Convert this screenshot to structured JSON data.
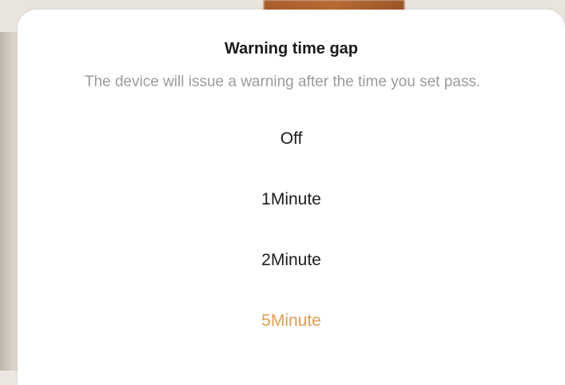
{
  "dialog": {
    "title": "Warning time gap",
    "subtitle": "The device will issue a warning after the time you set pass.",
    "options": [
      {
        "label": "Off",
        "selected": false
      },
      {
        "label": "1Minute",
        "selected": false
      },
      {
        "label": "2Minute",
        "selected": false
      },
      {
        "label": "5Minute",
        "selected": true
      }
    ],
    "selected_value": "5Minute"
  },
  "colors": {
    "accent": "#e19d57",
    "text_primary": "#1c1c1c",
    "text_secondary": "#9b9b9b",
    "sheet_background": "#ffffff"
  }
}
